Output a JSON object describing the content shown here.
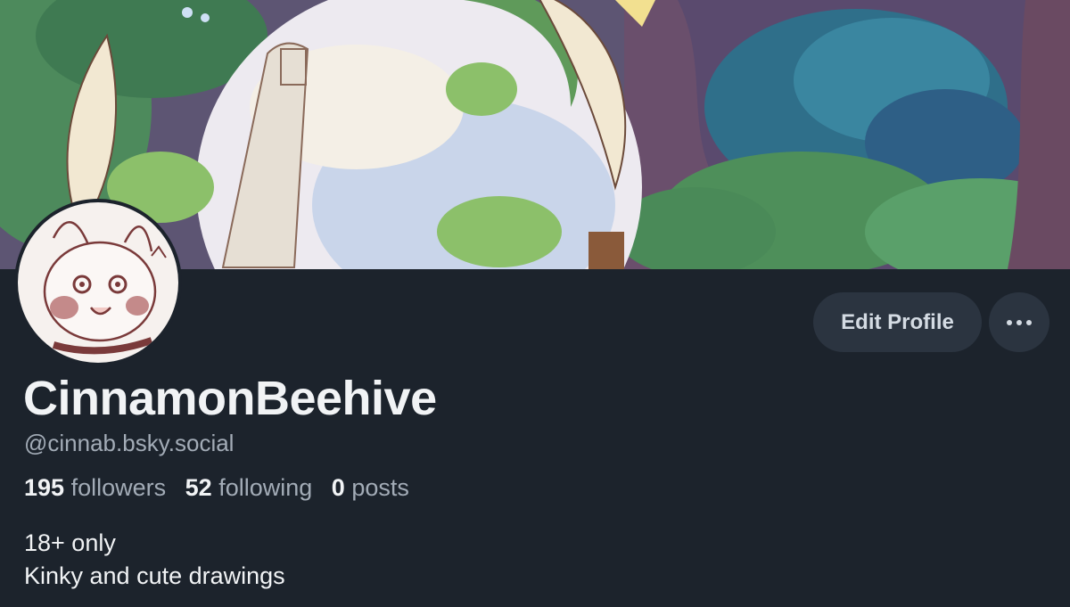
{
  "profile": {
    "display_name": "CinnamonBeehive",
    "handle": "@cinnab.bsky.social",
    "stats": {
      "followers_count": "195",
      "followers_label": "followers",
      "following_count": "52",
      "following_label": "following",
      "posts_count": "0",
      "posts_label": "posts"
    },
    "bio_lines": [
      "18+ only",
      "Kinky and cute drawings"
    ]
  },
  "actions": {
    "edit_profile_label": "Edit Profile",
    "more_icon": "ellipsis-icon"
  },
  "colors": {
    "background": "#1c232c",
    "button_bg": "#2b3440",
    "text_primary": "#f1f3f5",
    "text_secondary": "#a3acb7"
  }
}
